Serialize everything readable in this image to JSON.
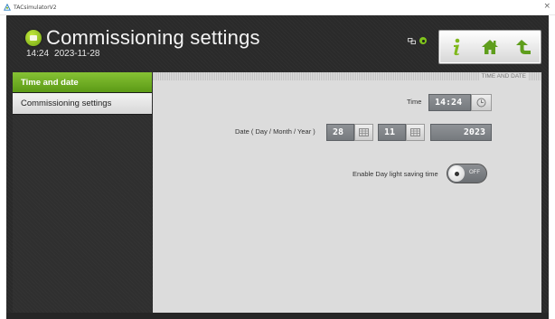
{
  "window": {
    "title": "TACsimulatorV2",
    "close_symbol": "×"
  },
  "header": {
    "title": "Commissioning settings",
    "time": "14:24",
    "date": "2023-11-28",
    "nav": [
      {
        "icon": "info-icon",
        "color": "#7fb81c"
      },
      {
        "icon": "home-icon",
        "color": "#5f9e1d"
      },
      {
        "icon": "back-icon",
        "color": "#5f9e1d"
      }
    ]
  },
  "sidebar": {
    "items": [
      {
        "label": "Time and date",
        "active": true
      },
      {
        "label": "Commissioning settings",
        "active": false
      }
    ]
  },
  "main": {
    "section_title": "TIME AND DATE",
    "time": {
      "label": "Time",
      "value": "14:24"
    },
    "date": {
      "label": "Date ( Day / Month / Year )",
      "day": "28",
      "month": "11",
      "year": "2023"
    },
    "dst": {
      "label": "Enable Day light saving time",
      "state": "OFF"
    }
  },
  "colors": {
    "accent": "#6fae1e",
    "panel": "#dcdcdc",
    "frame": "#2a2a2a"
  }
}
